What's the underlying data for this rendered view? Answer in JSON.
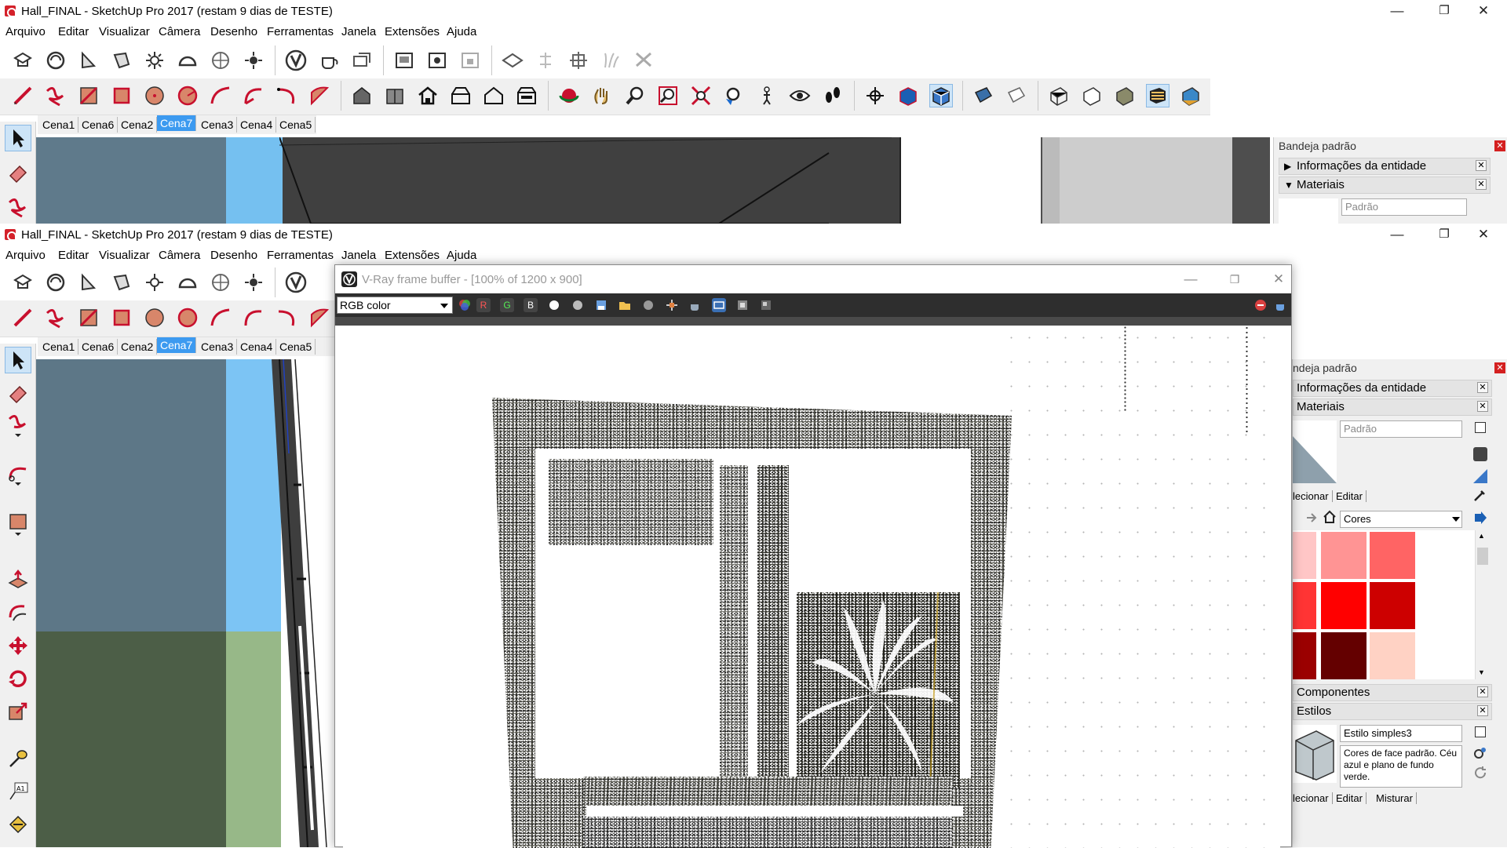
{
  "app": {
    "title": "Hall_FINAL - SketchUp Pro 2017 (restam 9 dias de TESTE)",
    "window_controls": {
      "minimize": "—",
      "maximize": "❐",
      "close": "✕"
    }
  },
  "menu": [
    "Arquivo",
    "Editar",
    "Visualizar",
    "Câmera",
    "Desenho",
    "Ferramentas",
    "Janela",
    "Extensões",
    "Ajuda"
  ],
  "scenes": {
    "tabs": [
      "Cena1",
      "Cena6",
      "Cena2",
      "Cena7",
      "Cena3",
      "Cena4",
      "Cena5"
    ],
    "active": "Cena7"
  },
  "tray": {
    "title": "Bandeja padrão",
    "title_bottom": "ndeja padrão",
    "entity_info": "Informações da entidade",
    "materials": "Materiais",
    "material_name": "Padrão",
    "tab_select": "lecionar",
    "tab_edit": "Editar",
    "tab_mix": "Misturar",
    "library": "Cores",
    "swatches": [
      "#ffc6c6",
      "#ff9494",
      "#ff6464",
      "#ff3434",
      "#ff0000",
      "#cd0000",
      "#9b0000",
      "#640000",
      "#ffd2c4",
      "#ff9a70",
      "#ff7a40",
      "#ff5a10"
    ],
    "components": "Componentes",
    "styles": "Estilos",
    "style_name": "Estilo simples3",
    "style_desc": "Cores de face padrão. Céu azul e plano de fundo verde."
  },
  "vray": {
    "title": "V-Ray frame buffer - [100% of 1200 x 900]",
    "channel": "RGB color",
    "btn_r": "R",
    "btn_g": "G",
    "btn_b": "B"
  },
  "colors": {
    "accent": "#3c9af0",
    "sky": "#5f7a8b",
    "ground": "#4c5e47",
    "viewport_dark": "#505050"
  }
}
